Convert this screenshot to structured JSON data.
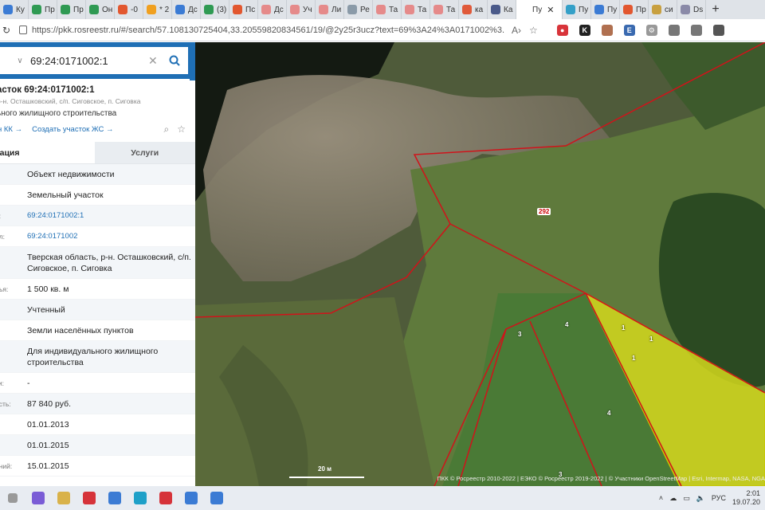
{
  "browser": {
    "tabs": [
      {
        "label": "Ку",
        "color": "#3b7bd4"
      },
      {
        "label": "Пр",
        "color": "#2f9a53"
      },
      {
        "label": "Пр",
        "color": "#2f9a53"
      },
      {
        "label": "Он",
        "color": "#2f9a53"
      },
      {
        "label": "-0",
        "color": "#e2572f"
      },
      {
        "label": "* 2",
        "color": "#f0a020"
      },
      {
        "label": "Дс",
        "color": "#3b7bd4"
      },
      {
        "label": "(3)",
        "color": "#2f9a53"
      },
      {
        "label": "Пс",
        "color": "#e2572f"
      },
      {
        "label": "Дс",
        "color": "#e58a8a"
      },
      {
        "label": "Уч",
        "color": "#e58a8a"
      },
      {
        "label": "Ли",
        "color": "#e58a8a"
      },
      {
        "label": "Ре",
        "color": "#8a9aa8"
      },
      {
        "label": "Та",
        "color": "#e58a8a"
      },
      {
        "label": "Та",
        "color": "#e58a8a"
      },
      {
        "label": "Та",
        "color": "#e58a8a"
      },
      {
        "label": "ка",
        "color": "#e05a3a"
      },
      {
        "label": "Ка",
        "color": "#4a5a8a"
      },
      {
        "label": "Пу",
        "color": "#ffffff"
      },
      {
        "label": "Пу",
        "color": "#34a0c8"
      },
      {
        "label": "Пу",
        "color": "#3b7bd4"
      },
      {
        "label": "Пр",
        "color": "#e2572f"
      },
      {
        "label": "си",
        "color": "#c8a040"
      },
      {
        "label": "Ds",
        "color": "#8a8aa8"
      }
    ],
    "active_tab_index": 18,
    "close_glyph": "✕",
    "new_tab_glyph": "+",
    "url": "https://pkk.rosreestr.ru/#/search/57.108130725404,33.20559820834561/19/@2y25r3ucz?text=69%3A24%3A0171002%3..."
  },
  "search": {
    "value": "69:24:0171002:1"
  },
  "object": {
    "title": "асток 69:24:0171002:1",
    "address": "р-н. Осташковский, с/п. Сиговское, п. Сиговка",
    "purpose": "ьного жилищного строительства",
    "link_kk": "н КК →",
    "link_create": "Создать участок ЖС →"
  },
  "tabs": {
    "info": "мация",
    "services": "Услуги"
  },
  "rows": [
    {
      "k": "",
      "v": "Объект недвижимости",
      "link": false
    },
    {
      "k": "",
      "v": "Земельный участок",
      "link": false
    },
    {
      "k": "р:",
      "v": "69:24:0171002:1",
      "link": true
    },
    {
      "k": "ал:",
      "v": "69:24:0171002",
      "link": true
    },
    {
      "k": "",
      "v": "Тверская область, р-н. Осташковский, с/п. Сиговское, п. Сиговка",
      "link": false
    },
    {
      "k": "дья:",
      "v": "1 500 кв. м",
      "link": false
    },
    {
      "k": "",
      "v": "Учтенный",
      "link": false
    },
    {
      "k": "",
      "v": "Земли населённых пунктов",
      "link": false
    },
    {
      "k": "",
      "v": "Для индивидуального жилищного строительства",
      "link": false
    },
    {
      "k": "ти:",
      "v": "-",
      "link": false
    },
    {
      "k": "ость:",
      "v": "87 840 руб.",
      "link": false
    },
    {
      "k": "",
      "v": "01.01.2013",
      "link": false
    },
    {
      "k": "",
      "v": "01.01.2015",
      "link": false
    },
    {
      "k": "ений:",
      "v": "15.01.2015",
      "link": false
    }
  ],
  "map": {
    "scale_label": "20 м",
    "attribution": "ПКК © Росреестр 2010-2022 | ЕЭКО © Росреестр 2019-2022 | © Участники OpenStreetMap | Esri, Intermap, NASA, NGA",
    "labels": [
      {
        "text": "292",
        "boxed": true
      },
      {
        "text": "3",
        "boxed": false
      },
      {
        "text": "4",
        "boxed": false
      },
      {
        "text": "1",
        "boxed": false
      },
      {
        "text": "1",
        "boxed": false
      },
      {
        "text": "1",
        "boxed": false
      },
      {
        "text": "4",
        "boxed": false
      },
      {
        "text": "3",
        "boxed": false
      }
    ]
  },
  "taskbar": {
    "apps": [
      "#7a5cd6",
      "#d9b24a",
      "#d6333a",
      "#3b7bd4",
      "#1ea0c8",
      "#d6333a",
      "#3b7bd4",
      "#3b7bd4"
    ],
    "lang": "РУС",
    "time": "2:01",
    "date": "19.07.20"
  }
}
